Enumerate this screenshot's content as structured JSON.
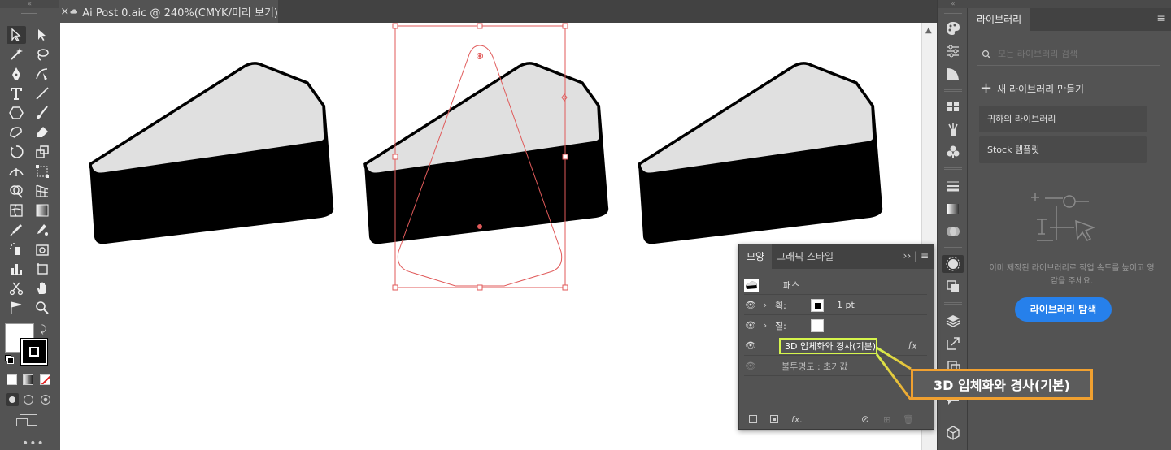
{
  "document_tab": {
    "close": "×",
    "title": "Ai Post 0.aic @ 240%(CMYK/미리 보기)"
  },
  "library_panel": {
    "tab": "라이브러리",
    "search_placeholder": "모든 라이브러리 검색",
    "new_library": "새 라이브러리 만들기",
    "rows": [
      "귀하의 라이브러리",
      "Stock 템플릿"
    ],
    "empty_text": "이미 제작된 라이브러리로 작업 속도를 높이고 영감을 주세요.",
    "explore_button": "라이브러리 탐색"
  },
  "appearance_panel": {
    "tabs": [
      "모양",
      "그래픽 스타일"
    ],
    "object": "패스",
    "stroke_label": "획:",
    "stroke_value": "1 pt",
    "fill_label": "칠:",
    "effect": "3D 입체화와 경사(기본)",
    "opacity": "불투명도 : 초기값",
    "fx": "fx"
  },
  "callout": {
    "text": "3D 입체화와 경사(기본)"
  },
  "colors": {
    "accent": "#2680eb",
    "callout_border": "#f0a030",
    "highlight": "#d6f54c",
    "selection": "#e05a5a"
  }
}
